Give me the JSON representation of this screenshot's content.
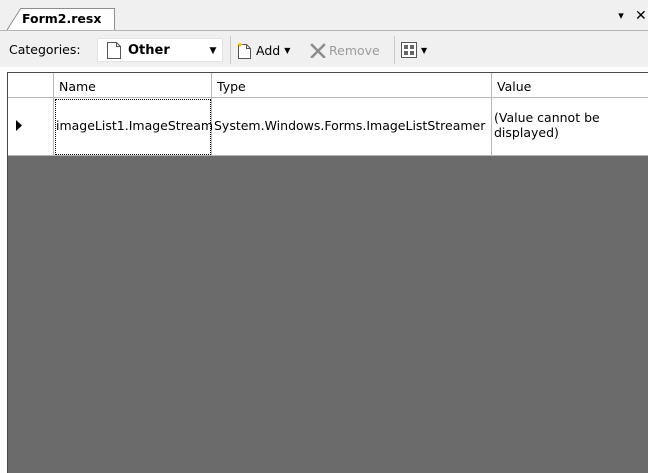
{
  "tab": {
    "title": "Form2.resx",
    "dropdown_glyph": "▾",
    "close_glyph": "✕"
  },
  "toolbar": {
    "categories_label": "Categories:",
    "category_value": "Other",
    "add_label": "Add",
    "remove_label": "Remove"
  },
  "grid": {
    "columns": [
      "",
      "Name",
      "Type",
      "Value"
    ],
    "rows": [
      {
        "selected": true,
        "name": "imageList1.ImageStream",
        "type": "System.Windows.Forms.ImageListStreamer",
        "value": "(Value cannot be displayed)"
      }
    ]
  },
  "colors": {
    "grid_background": "#6b6b6b",
    "toolbar_background": "#f0f0f0",
    "remove_icon": "#8c8c8c"
  }
}
